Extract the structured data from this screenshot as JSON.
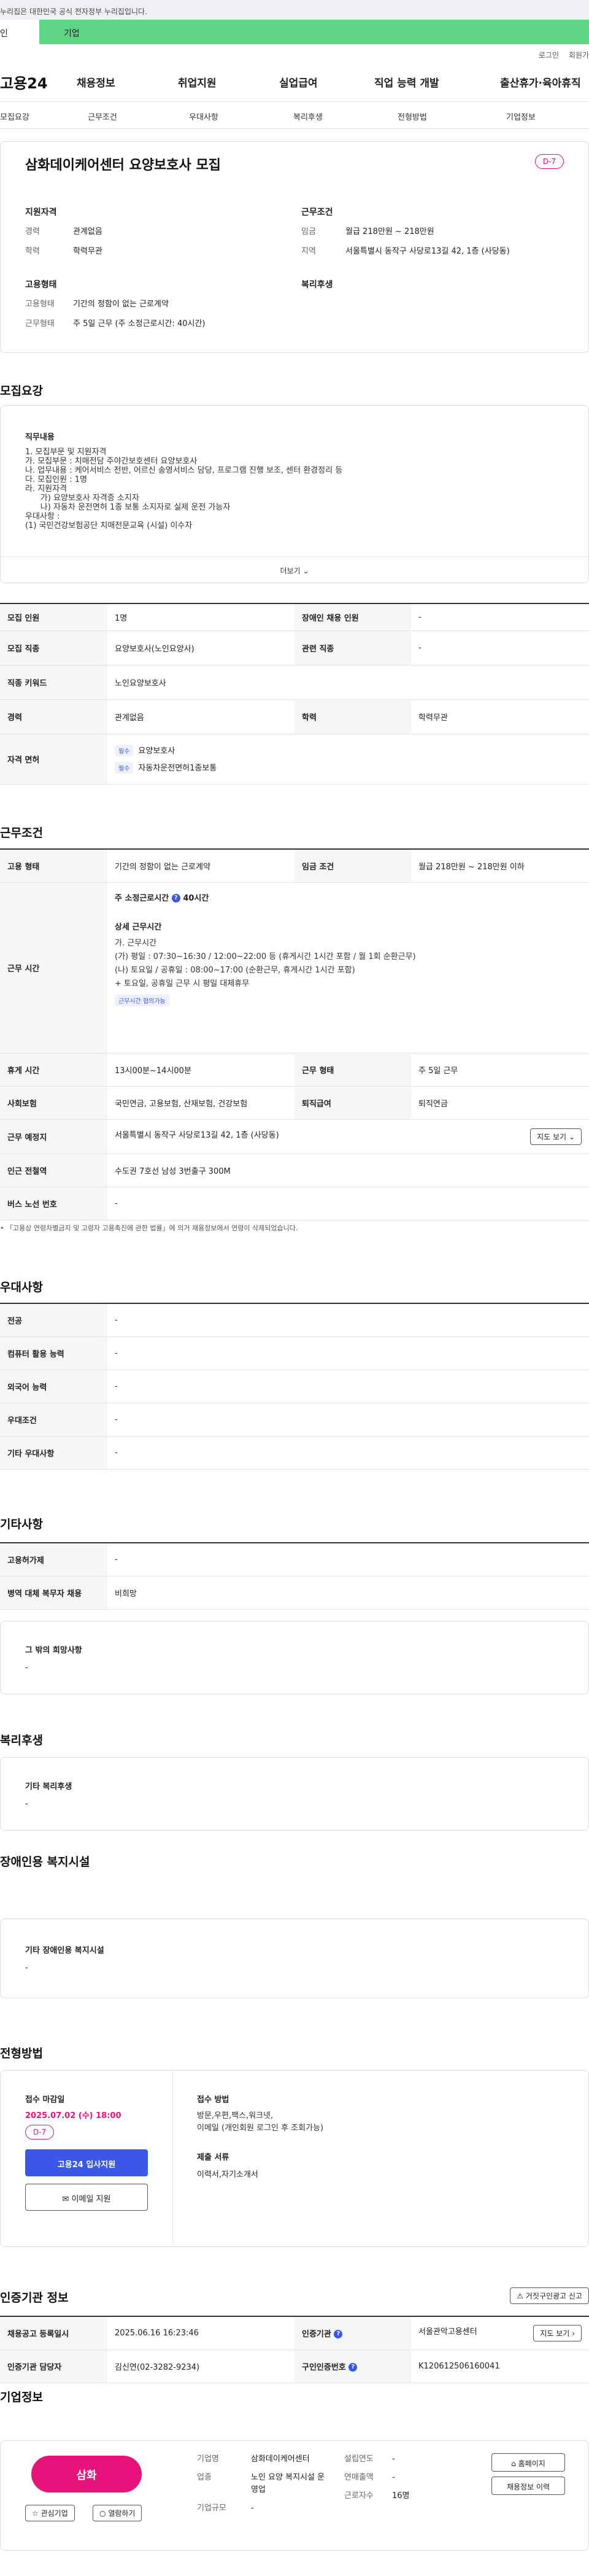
{
  "gov_notice": "누리집은 대한민국 공식 전자정부 누리집입니다.",
  "user_tabs": {
    "personal": "인",
    "company": "기업"
  },
  "util_links": [
    "로그인",
    "회원가"
  ],
  "gnb": {
    "logo": "고용24",
    "menu": [
      "채용정보",
      "취업지원",
      "실업급여",
      "직업 능력 개발",
      "출산휴가·육아휴직"
    ]
  },
  "subnav": [
    "모집요강",
    "근무조건",
    "우대사항",
    "복리후생",
    "전형방법",
    "기업정보"
  ],
  "summary": {
    "title": "삼화데이케어센터 요양보호사 모집",
    "dday": "D-7",
    "qualification": {
      "heading": "지원자격",
      "rows": [
        {
          "k": "경력",
          "v": "관계없음"
        },
        {
          "k": "학력",
          "v": "학력무관"
        }
      ]
    },
    "conditions": {
      "heading": "근무조건",
      "rows": [
        {
          "k": "임금",
          "v": "월급 218만원 ~ 218만원"
        },
        {
          "k": "지역",
          "v": "서울특별시 동작구 사당로13길 42, 1층 (사당동)"
        }
      ]
    },
    "employment": {
      "heading": "고용형태",
      "rows": [
        {
          "k": "고용형태",
          "v": "기간의 정함이 없는 근로계약"
        },
        {
          "k": "근무형태",
          "v": "주 5일 근무 (주 소정근로시간: 40시간)"
        }
      ]
    },
    "welfare": {
      "heading": "복리후생"
    }
  },
  "recruit": {
    "section_title": "모집요강",
    "duty_heading": "직무내용",
    "duty_text": "1. 모집부문 및 지원자격\n가. 모집부문 : 치매전담 주야간보호센터 요양보호사\n나. 업무내용 : 케어서비스 전반, 어르신 송영서비스 담당, 프로그램 진행 보조, 센터 환경정리 등\n다. 모집인원 : 1명\n라. 지원자격\n      가) 요양보호사 자격증 소지자\n      나) 자동차 운전면허 1종 보통 소지자로 실제 운전 가능자\n우대사항 :\n(1) 국민건강보험공단 치매전문교육 (시설) 이수자",
    "more_label": "더보기",
    "table": {
      "headcount_label": "모집 인원",
      "headcount": "1명",
      "disabled_label": "장애인 채용 인원",
      "disabled": "-",
      "job_label": "모집 직종",
      "job": "요양보호사(노인요양사)",
      "related_label": "관련 직종",
      "related": "-",
      "keyword_label": "직종 키워드",
      "keyword": "노인요양보호사",
      "career_label": "경력",
      "career": "관계없음",
      "edu_label": "학력",
      "edu": "학력무관",
      "license_label": "자격 면허",
      "licenses": [
        {
          "tag": "필수",
          "name": "요양보호사"
        },
        {
          "tag": "필수",
          "name": "자동차운전면허1종보통"
        }
      ]
    }
  },
  "work": {
    "section_title": "근무조건",
    "emp_type_label": "고용 형태",
    "emp_type": "기간의 정함이 없는 근로계약",
    "wage_label": "임금 조건",
    "wage": "월급 218만원 ~ 218만원 이하",
    "hours_label": "근무 시간",
    "hours_weekly": "주 소정근로시간",
    "hours_weekly_value": "40시간",
    "hours_detail_title": "상세 근무시간",
    "hours_detail": "가. 근무시간\n(가) 평일 : 07:30~16:30 / 12:00~22:00 등 (휴게시간 1시간 포함 / 월 1회 순환근무)\n(나) 토요일 / 공휴일 : 08:00~17:00 (순환근무, 휴게시간 1시간 포함)\n+ 토요일, 공휴일 근무 시 평일 대체휴무",
    "hours_tag": "근무시간 협의가능",
    "break_label": "휴게 시간",
    "break": "13시00분~14시00분",
    "shape_label": "근무 형태",
    "shape": "주 5일 근무",
    "insurance_label": "사회보험",
    "insurance": "국민연금, 고용보험, 산재보험, 건강보험",
    "retire_label": "퇴직급여",
    "retire": "퇴직연금",
    "place_label": "근무 예정지",
    "place": "서울특별시 동작구 사당로13길 42, 1층 (사당동)",
    "map_btn": "지도 보기",
    "subway_label": "인근 전철역",
    "subway": "수도권 7호선 남성 3번출구 300M",
    "bus_label": "버스 노선 번호",
    "bus": "-",
    "notice": "「고용상 연령차별금지 및 고령자 고용촉진에 관한 법률」에 의거 채용정보에서 연령이 삭제되었습니다."
  },
  "pref": {
    "section_title": "우대사항",
    "rows": [
      {
        "k": "전공",
        "v": "-"
      },
      {
        "k": "컴퓨터 활용 능력",
        "v": "-"
      },
      {
        "k": "외국어 능력",
        "v": "-"
      },
      {
        "k": "우대조건",
        "v": "-"
      },
      {
        "k": "기타 우대사항",
        "v": "-"
      }
    ]
  },
  "other": {
    "section_title": "기타사항",
    "rows": [
      {
        "k": "고용허가제",
        "v": "-"
      },
      {
        "k": "병역 대체 복무자 채용",
        "v": "비희망"
      }
    ],
    "extra_heading": "그 밖의 희망사항",
    "extra_value": "-"
  },
  "welfare": {
    "section_title": "복리후생",
    "heading": "기타 복리후생",
    "value": "-"
  },
  "disabled_fac": {
    "section_title": "장애인용 복지시설",
    "heading": "기타 장애인용 복지시설",
    "value": "-"
  },
  "selection": {
    "section_title": "전형방법",
    "deadline_label": "접수 마감일",
    "deadline": "2025.07.02 (수) 18:00",
    "dday": "D-7",
    "apply_btn": "고용24 입사지원",
    "email_btn": "이메일 지원",
    "method_label": "접수 방법",
    "method": "방문,우편,팩스,워크넷,\n이메일 (개인회원 로그인 후 조회가능)",
    "docs_label": "제출 서류",
    "docs": "이력서,자기소개서"
  },
  "cert": {
    "section_title": "인증기관 정보",
    "report_btn": "거짓구인광고 신고",
    "reg_label": "채용공고 등록일시",
    "reg": "2025.06.16 16:23:46",
    "agency_label": "인증기관",
    "agency": "서울관악고용센터",
    "map_btn": "지도 보기",
    "manager_label": "인증기관 담당자",
    "manager": "김신연(02-3282-9234)",
    "id_label": "구인인증번호",
    "id": "K120612506160041"
  },
  "company": {
    "section_title": "기업정보",
    "logo_text": "삼화",
    "fav_btn": "관심기업",
    "follow_btn": "열람하기",
    "name_label": "기업명",
    "name": "삼화데이케어센터",
    "industry_label": "업종",
    "industry": "노인 요양 복지시설 운영업",
    "size_label": "기업규모",
    "size": "-",
    "founded_label": "설립연도",
    "founded": "-",
    "revenue_label": "연매출액",
    "revenue": "-",
    "employees_label": "근로자수",
    "employees": "16명",
    "homepage_btn": "홈페이지",
    "jobs_btn": "채용정보 이력"
  }
}
